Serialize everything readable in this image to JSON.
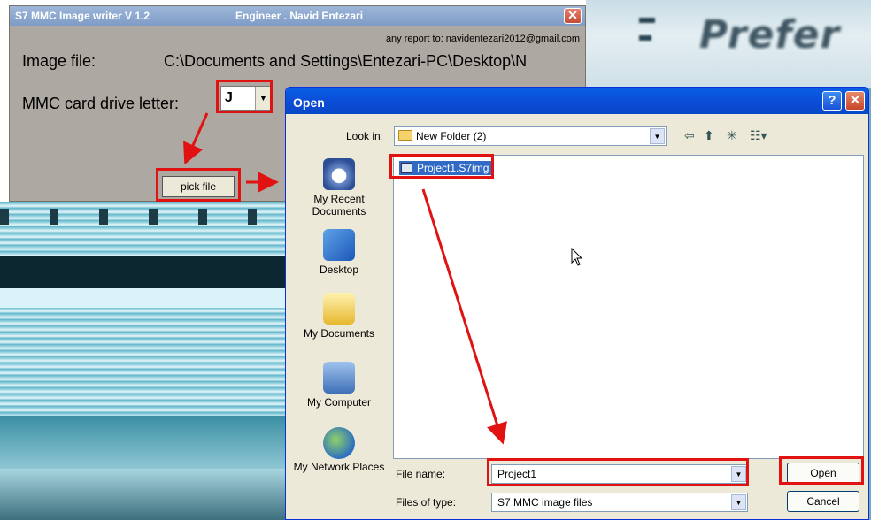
{
  "app": {
    "title": "S7 MMC Image writer V 1.2",
    "author": "Engineer . Navid Entezari",
    "close_glyph": "✕",
    "report": "any report to: navidentezari2012@gmail.com",
    "image_file_label": "Image file:",
    "image_file_path": "C:\\Documents and Settings\\Entezari-PC\\Desktop\\N",
    "mmc_label": "MMC card drive letter:",
    "drive_value": "J",
    "pick_button": "pick file"
  },
  "dialog": {
    "title": "Open",
    "help_glyph": "?",
    "close_glyph": "✕",
    "look_in_label": "Look in:",
    "look_in_value": "New Folder (2)",
    "places": [
      {
        "label": "My Recent Documents",
        "icon": "recent-documents-icon"
      },
      {
        "label": "Desktop",
        "icon": "desktop-icon"
      },
      {
        "label": "My Documents",
        "icon": "my-documents-icon"
      },
      {
        "label": "My Computer",
        "icon": "my-computer-icon"
      },
      {
        "label": "My Network Places",
        "icon": "network-places-icon"
      }
    ],
    "files": [
      {
        "name": "Project1.S7img",
        "icon": "image-file-icon"
      }
    ],
    "file_name_label": "File name:",
    "file_name_value": "Project1",
    "file_type_label": "Files of type:",
    "file_type_value": "S7 MMC image files",
    "open_button": "Open",
    "cancel_button": "Cancel"
  },
  "colors": {
    "highlight": "#e01212",
    "xp_title_blue": "#0b4dd8",
    "selection_blue": "#316ac5",
    "app_body": "#ada8a1"
  }
}
